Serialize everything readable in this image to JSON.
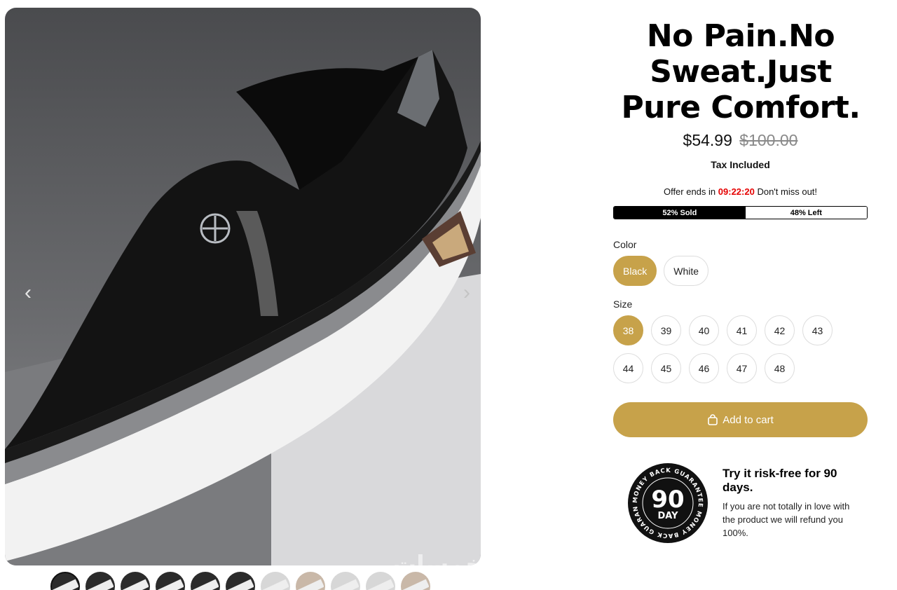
{
  "gallery": {
    "prev_icon": "chevron-left-icon",
    "next_icon": "chevron-right-icon",
    "thumbnails": [
      {
        "shade": "dark"
      },
      {
        "shade": "dark"
      },
      {
        "shade": "dark"
      },
      {
        "shade": "dark"
      },
      {
        "shade": "dark"
      },
      {
        "shade": "dark"
      },
      {
        "shade": "light"
      },
      {
        "shade": "mid"
      },
      {
        "shade": "light"
      },
      {
        "shade": "light"
      },
      {
        "shade": "mid"
      }
    ],
    "watermark": "خمسات"
  },
  "product": {
    "title": "No Pain.No Sweat.Just Pure Comfort.",
    "price": "$54.99",
    "compare_price": "$100.00",
    "tax_note": "Tax Included",
    "offer_prefix": "Offer ends in",
    "offer_timer": "09:22:20",
    "offer_suffix": "Don't miss out!",
    "stock": {
      "sold_label": "52% Sold",
      "left_label": "48% Left",
      "sold_fraction": 0.52
    },
    "color_label": "Color",
    "colors": [
      "Black",
      "White"
    ],
    "selected_color": "Black",
    "size_label": "Size",
    "sizes": [
      "38",
      "39",
      "40",
      "41",
      "42",
      "43",
      "44",
      "45",
      "46",
      "47",
      "48"
    ],
    "selected_size": "38",
    "add_to_cart": "Add to cart",
    "cart_icon": "shopping-bag-icon",
    "accent_color": "#c7a24a",
    "timer_color": "#e50000"
  },
  "guarantee": {
    "badge_number": "90",
    "badge_unit": "DAY",
    "badge_ring_text": "MONEY BACK GUARANTEE MONEY BACK GUARANTEE",
    "title": "Try it risk-free for 90 days.",
    "body": "If you are not totally in love with the product we will refund you 100%."
  }
}
